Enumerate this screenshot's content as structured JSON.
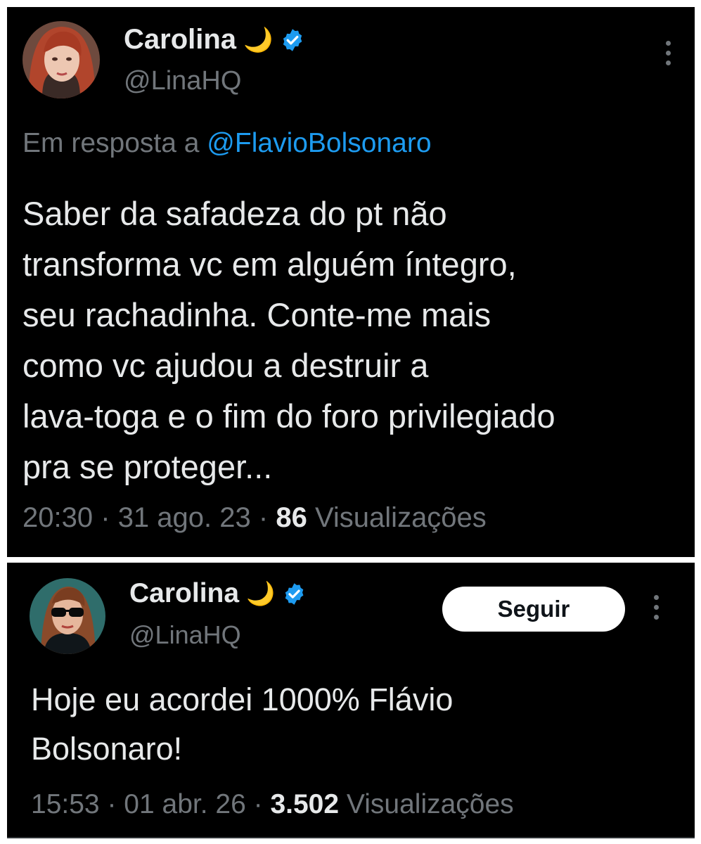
{
  "tweets": [
    {
      "author": {
        "name": "Carolina",
        "emoji": "🌙",
        "handle": "@LinaHQ",
        "verified": true
      },
      "reply_to": {
        "prefix": "Em resposta a",
        "handle": "@FlavioBolsonaro"
      },
      "text_lines": [
        "Saber da safadeza do pt não",
        "transforma vc em alguém íntegro,",
        "seu rachadinha. Conte-me mais",
        "como vc ajudou a destruir a",
        "lava-toga e o fim do foro privilegiado",
        "pra se proteger..."
      ],
      "time": "20:30",
      "date": "31 ago. 23",
      "views_count": "86",
      "views_label": "Visualizações"
    },
    {
      "author": {
        "name": "Carolina",
        "emoji": "🌙",
        "handle": "@LinaHQ",
        "verified": true
      },
      "follow_label": "Seguir",
      "text_lines": [
        "Hoje eu acordei 1000% Flávio",
        "Bolsonaro!"
      ],
      "time": "15:53",
      "date": "01 abr. 26",
      "views_count": "3.502",
      "views_label": "Visualizações"
    }
  ],
  "colors": {
    "background": "#000000",
    "text": "#e7e9ea",
    "muted": "#71767b",
    "link": "#1d9bf0",
    "verified": "#1d9bf0",
    "button_bg": "#ffffff"
  },
  "icons": {
    "verified": "verified-badge-icon",
    "more": "more-options-icon",
    "moon": "crescent-moon-emoji"
  }
}
